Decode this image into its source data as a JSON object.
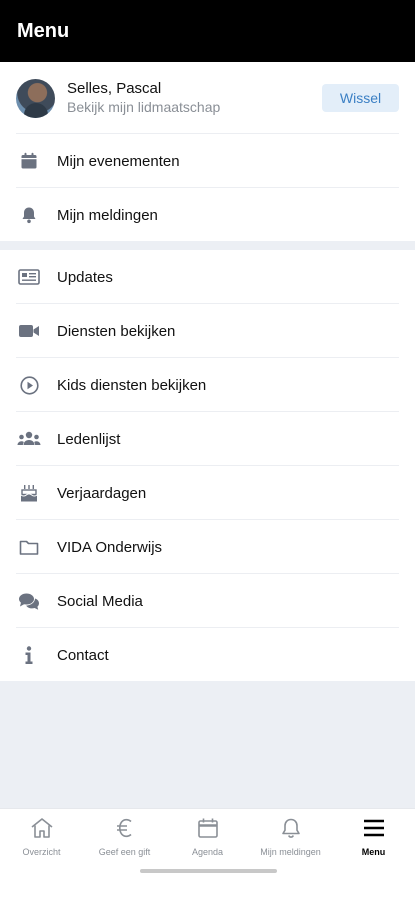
{
  "header": {
    "title": "Menu"
  },
  "profile": {
    "name": "Selles, Pascal",
    "subtitle": "Bekijk mijn lidmaatschap",
    "switch_label": "Wissel"
  },
  "menu_top": [
    {
      "icon": "calendar-icon",
      "label": "Mijn evenementen"
    },
    {
      "icon": "bell-icon",
      "label": "Mijn meldingen"
    }
  ],
  "menu_main": [
    {
      "icon": "news-icon",
      "label": "Updates"
    },
    {
      "icon": "video-camera-icon",
      "label": "Diensten bekijken"
    },
    {
      "icon": "play-circle-icon",
      "label": "Kids diensten bekijken"
    },
    {
      "icon": "users-icon",
      "label": "Ledenlijst"
    },
    {
      "icon": "birthday-cake-icon",
      "label": "Verjaardagen"
    },
    {
      "icon": "folder-icon",
      "label": "VIDA Onderwijs"
    },
    {
      "icon": "chat-bubbles-icon",
      "label": "Social Media"
    },
    {
      "icon": "info-icon",
      "label": "Contact"
    }
  ],
  "tabbar": [
    {
      "icon": "home-icon",
      "label": "Overzicht",
      "active": false
    },
    {
      "icon": "euro-icon",
      "label": "Geef een gift",
      "active": false
    },
    {
      "icon": "calendar-icon",
      "label": "Agenda",
      "active": false
    },
    {
      "icon": "bell-icon",
      "label": "Mijn meldingen",
      "active": false
    },
    {
      "icon": "hamburger-menu-icon",
      "label": "Menu",
      "active": true
    }
  ],
  "colors": {
    "header_bg": "#000000",
    "accent": "#3a7fc4",
    "accent_bg": "#e3eef9",
    "icon_gray": "#6b7280",
    "separator_bg": "#eceff4"
  }
}
